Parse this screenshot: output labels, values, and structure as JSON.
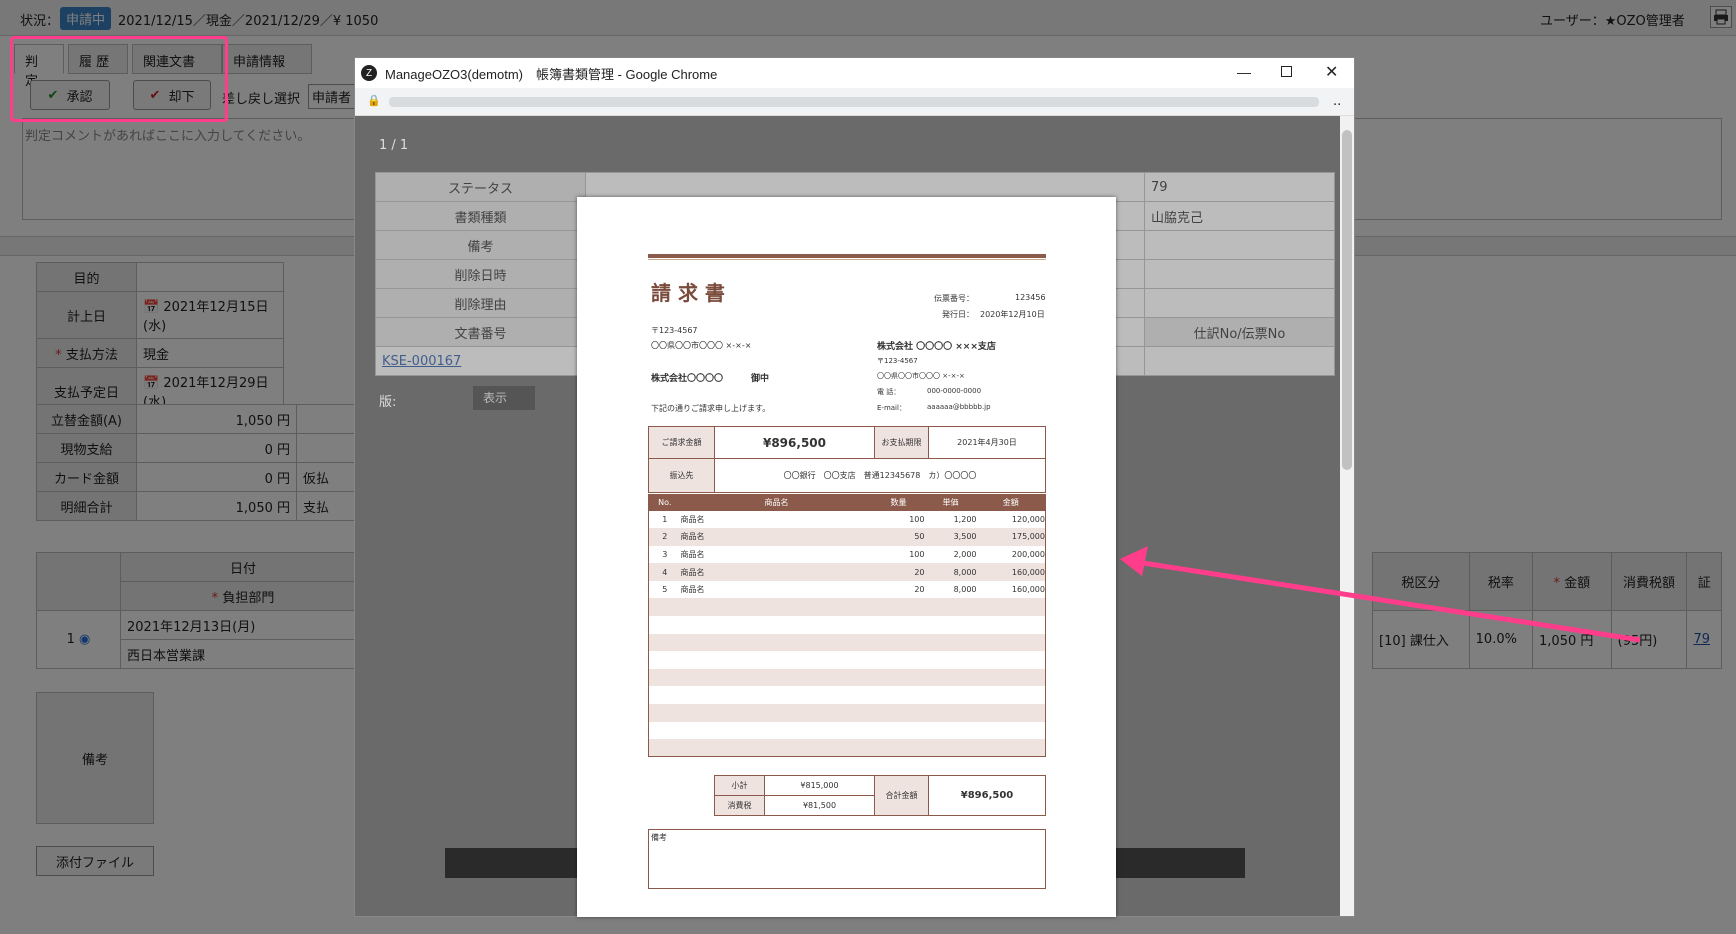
{
  "status_bar": {
    "label": "状況：",
    "badge": "申請中",
    "summary": "2021/12/15／現金／2021/12/29／¥ 1050",
    "user": "ユーザー：★OZO管理者"
  },
  "tabs": [
    {
      "label": "判 定"
    },
    {
      "label": "履 歴"
    },
    {
      "label": "関連文書"
    },
    {
      "label": "申請情報"
    }
  ],
  "actions": {
    "approve": "承認",
    "reject": "却下",
    "send_back": "差し戻し選択",
    "applicant": "申請者"
  },
  "comment_placeholder": "判定コメントがあればここに入力してください。",
  "info": {
    "purpose_label": "目的",
    "purpose_value": "",
    "posting_date_label": "計上日",
    "posting_date_value": "2021年12月15日(水)",
    "payment_method_label": "支払方法",
    "payment_method_value": "現金",
    "due_date_label": "支払予定日",
    "due_date_value": "2021年12月29日(水)"
  },
  "amounts": [
    {
      "label": "立替金額(A)",
      "value": "1,050 円",
      "extra": ""
    },
    {
      "label": "現物支給",
      "value": "0 円",
      "extra": ""
    },
    {
      "label": "カード金額",
      "value": "0 円",
      "extra": "仮払"
    },
    {
      "label": "明細合計",
      "value": "1,050 円",
      "extra": "支払"
    }
  ],
  "detail": {
    "date_header": "日付",
    "dept_header": "負担部門",
    "row_no": "1",
    "row_date": "2021年12月13日(月)",
    "row_dept": "西日本営業課",
    "right_headers": [
      "税区分",
      "税率",
      "金額",
      "消費税額",
      "証"
    ],
    "right_values": [
      "[10] 課仕入",
      "10.0%",
      "1,050 円",
      "(95円)",
      "79"
    ]
  },
  "notes_label": "備考",
  "attach_label": "添付ファイル",
  "chrome": {
    "title": "ManageOZO3(demotm)　帳簿書類管理 - Google Chrome",
    "address_end": ".."
  },
  "viewer": {
    "page_count": "1 / 1",
    "rows": [
      {
        "label": "ステータス",
        "value": "",
        "right_value": "79"
      },
      {
        "label": "書類種類",
        "value": "",
        "right_value": "山脇克己"
      },
      {
        "label": "備考",
        "value": "",
        "right_value": ""
      },
      {
        "label": "削除日時",
        "value": "",
        "right_value": ""
      },
      {
        "label": "削除理由",
        "value": "",
        "right_value": ""
      }
    ],
    "doc_no_header": "文書番号",
    "journal_header": "仕訳No/伝票No",
    "doc_link": "KSE-000167",
    "version_label": "版:",
    "show_button": "表示"
  },
  "invoice": {
    "title": "請 求 書",
    "slip_label": "伝票番号：",
    "slip_no": "123456",
    "issue_label": "発行日：",
    "issue_date": "2020年12月10日",
    "zip": "〒123-4567",
    "addr": "〇〇県〇〇市〇〇〇 ×-×-×",
    "client": "株式会社〇〇〇〇",
    "onchu": "御中",
    "vendor": "株式会社 〇〇〇〇 ×××支店",
    "vendor_zip": "〒123-4567",
    "vendor_addr": "〇〇県〇〇市〇〇〇 ×-×-×",
    "tel_label": "電 話：",
    "tel": "000-0000-0000",
    "email_label": "E-mail：",
    "email": "aaaaaa@bbbbb.jp",
    "greeting": "下記の通りご請求申し上げます。",
    "amount_label": "ご請求金額",
    "amount": "¥896,500",
    "due_label": "お支払期限",
    "due": "2021年4月30日",
    "bank_label": "振込先",
    "bank": "〇〇銀行　〇〇支店　普通12345678　カ）〇〇〇〇",
    "headers": [
      "No.",
      "商品名",
      "数量",
      "単価",
      "金額"
    ],
    "items": [
      {
        "no": "1",
        "name": "商品名",
        "qty": "100",
        "price": "1,200",
        "amount": "120,000"
      },
      {
        "no": "2",
        "name": "商品名",
        "qty": "50",
        "price": "3,500",
        "amount": "175,000"
      },
      {
        "no": "3",
        "name": "商品名",
        "qty": "100",
        "price": "2,000",
        "amount": "200,000"
      },
      {
        "no": "4",
        "name": "商品名",
        "qty": "20",
        "price": "8,000",
        "amount": "160,000"
      },
      {
        "no": "5",
        "name": "商品名",
        "qty": "20",
        "price": "8,000",
        "amount": "160,000"
      }
    ],
    "subtotal_label": "小計",
    "subtotal": "¥815,000",
    "tax_label": "消費税",
    "tax": "¥81,500",
    "total_label": "合計金額",
    "total": "¥896,500",
    "remarks_label": "備考"
  },
  "colors": {
    "highlight": "#ff3d8b",
    "arrow": "#ff3d8b",
    "badge": "#3b82c4",
    "invoice_brown": "#8b5a4a"
  }
}
